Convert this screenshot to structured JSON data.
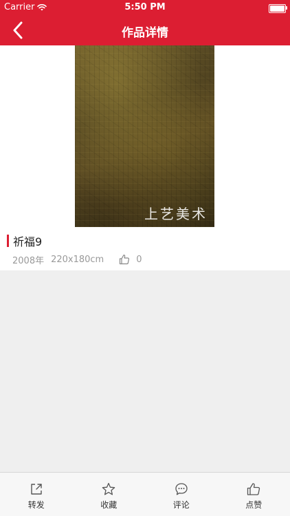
{
  "status_bar": {
    "carrier": "Carrier",
    "time": "5:50 PM",
    "battery_level": 1.0
  },
  "nav": {
    "title": "作品详情",
    "back_icon": "chevron-left-icon"
  },
  "artwork": {
    "watermark": "上艺美术",
    "title": "祈福9",
    "year": "2008年",
    "dimensions": "220x180cm",
    "like_count": "0",
    "like_icon": "thumbs-up-icon"
  },
  "tab_bar": {
    "items": [
      {
        "label": "转发",
        "icon": "share-icon"
      },
      {
        "label": "收藏",
        "icon": "star-icon"
      },
      {
        "label": "评论",
        "icon": "comment-icon"
      },
      {
        "label": "点赞",
        "icon": "thumbs-up-icon"
      }
    ]
  },
  "colors": {
    "accent": "#dc1e32",
    "background": "#efefef",
    "meta_text": "#999999"
  }
}
